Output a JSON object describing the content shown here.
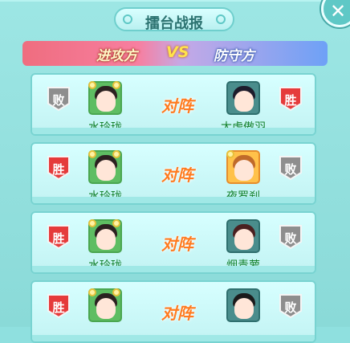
{
  "window": {
    "title": "擂台战报",
    "close_label": "✕"
  },
  "banner": {
    "attacker_label": "进攻方",
    "vs_label": "VS",
    "defender_label": "防守方"
  },
  "colors": {
    "win_red": "#e53b3b",
    "lose_gray": "#8e8e8e",
    "name_green": "#15812c",
    "vs_orange": "#ff7b1f"
  },
  "matches": [
    {
      "attacker": {
        "name": "水玲珑",
        "result": "败"
      },
      "vs_label": "对阵",
      "defender": {
        "name": "太虚傲羽",
        "result": "胜"
      }
    },
    {
      "attacker": {
        "name": "水玲珑",
        "result": "胜"
      },
      "vs_label": "对阵",
      "defender": {
        "name": "夜罗刹",
        "result": "败"
      }
    },
    {
      "attacker": {
        "name": "水玲珑",
        "result": "胜"
      },
      "vs_label": "对阵",
      "defender": {
        "name": "烟青萝",
        "result": "败"
      }
    },
    {
      "attacker": {
        "name": "",
        "result": "胜"
      },
      "vs_label": "对阵",
      "defender": {
        "name": "",
        "result": "败"
      }
    }
  ]
}
